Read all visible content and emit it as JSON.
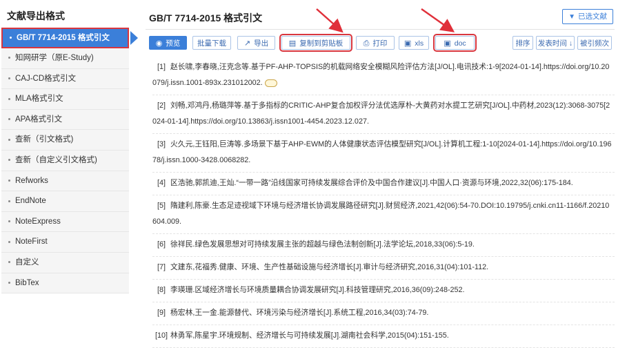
{
  "sidebar": {
    "title": "文献导出格式",
    "items": [
      {
        "label": "GB/T 7714-2015 格式引文",
        "active": true
      },
      {
        "label": "知网研学（原E-Study)"
      },
      {
        "label": "CAJ-CD格式引文"
      },
      {
        "label": "MLA格式引文"
      },
      {
        "label": "APA格式引文"
      },
      {
        "label": "查新（引文格式)"
      },
      {
        "label": "查新（自定义引文格式)"
      },
      {
        "label": "Refworks"
      },
      {
        "label": "EndNote"
      },
      {
        "label": "NoteExpress"
      },
      {
        "label": "NoteFirst"
      },
      {
        "label": "自定义"
      },
      {
        "label": "BibTex"
      }
    ]
  },
  "main": {
    "title": "GB/T 7714-2015 格式引文",
    "selected_label": "已选文献"
  },
  "toolbar": {
    "preview": "预览",
    "batch_download": "批量下载",
    "export": "导出",
    "copy_clipboard": "复制到剪贴板",
    "print": "打印",
    "xls": "xls",
    "doc": "doc",
    "sort": "排序",
    "publish_time": "发表时间",
    "cited_count": "被引频次"
  },
  "icons": {
    "filter": "filter-icon",
    "preview": "eye-icon",
    "export": "export-icon",
    "copy": "clipboard-icon",
    "print": "printer-icon",
    "xls": "excel-icon",
    "doc": "word-icon"
  },
  "colors": {
    "accent": "#3b7fd9",
    "highlight": "#d9363e"
  },
  "references": [
    {
      "num": "[1]",
      "text": "赵长啸,李春晓,汪克念等.基于PF-AHP-TOPSIS的机载网络安全模糊风险评估方法[J/OL].电讯技术:1-9[2024-01-14].https://doi.org/10.20",
      "text2": "079/j.issn.1001-893x.231012002."
    },
    {
      "num": "[2]",
      "text": "刘畅,邓鸿丹,杨璐萍等.基于多指标的CRITIC-AHP复合加权评分法优选厚朴-大黄药对水提工艺研究[J/OL].中药材,2023(12):3068-3075[2",
      "text2": "024-01-14].https://doi.org/10.13863/j.issn1001-4454.2023.12.027."
    },
    {
      "num": "[3]",
      "text": "火久元,王钰阳,巨涛等.多场景下基于AHP-EWM的人体健康状态评估模型研究[J/OL].计算机工程:1-10[2024-01-14].https://doi.org/10.196",
      "text2": "78/j.issn.1000-3428.0068282."
    },
    {
      "num": "[4]",
      "text": "区浩驰,郭凯迪,王灿.“一带一路”沿线国家可持续发展综合评价及中国合作建议[J].中国人口·资源与环境,2022,32(06):175-184.",
      "text2": ""
    },
    {
      "num": "[5]",
      "text": "隋建利,陈豪.生态足迹视域下环境与经济增长协调发展路径研究[J].财贸经济,2021,42(06):54-70.DOI:10.19795/j.cnki.cn11-1166/f.20210",
      "text2": "604.009."
    },
    {
      "num": "[6]",
      "text": "徐祥民.绿色发展思想对可持续发展主张的超越与绿色法制创新[J].法学论坛,2018,33(06):5-19.",
      "text2": ""
    },
    {
      "num": "[7]",
      "text": "文建东,花福秀.健康、环境、生产性基础设施与经济增长[J].审计与经济研究,2016,31(04):101-112.",
      "text2": ""
    },
    {
      "num": "[8]",
      "text": "李瑛珊.区域经济增长与环境质量耦合协调发展研究[J].科技管理研究,2016,36(09):248-252.",
      "text2": ""
    },
    {
      "num": "[9]",
      "text": "杨宏林,王一金.能源替代、环境污染与经济增长[J].系统工程,2016,34(03):74-79.",
      "text2": ""
    },
    {
      "num": "[10]",
      "text": "林勇军,陈星宇.环境规制、经济增长与可持续发展[J].湖南社会科学,2015(04):151-155.",
      "text2": ""
    }
  ]
}
